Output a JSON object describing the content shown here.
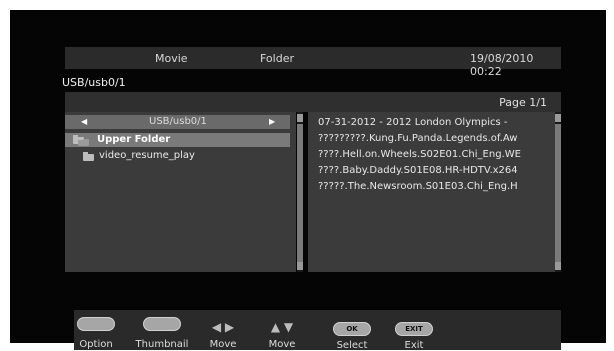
{
  "header": {
    "col1": "Movie",
    "col2": "Folder",
    "datetime": "19/08/2010 00:22"
  },
  "path": "USB/usb0/1",
  "page_label": "Page 1/1",
  "device": {
    "label": "USB/usb0/1"
  },
  "folders": {
    "upper": "Upper Folder",
    "items": [
      "video_resume_play"
    ]
  },
  "files": [
    "07-31-2012 - 2012 London Olympics - ",
    "?????????.Kung.Fu.Panda.Legends.of.Aw",
    "????.Hell.on.Wheels.S02E01.Chi_Eng.WE",
    "????.Baby.Daddy.S01E08.HR-HDTV.x264",
    "?????.The.Newsroom.S01E03.Chi_Eng.H"
  ],
  "footer": {
    "option": "Option",
    "thumbnail": "Thumbnail",
    "move_lr": "Move",
    "move_ud": "Move",
    "ok_key": "OK",
    "select": "Select",
    "exit_key": "EXIT",
    "exit": "Exit"
  },
  "icons": {
    "left": "triangle-left",
    "right": "triangle-right",
    "folder": "folder-icon",
    "ud": "triangle-up-down"
  }
}
